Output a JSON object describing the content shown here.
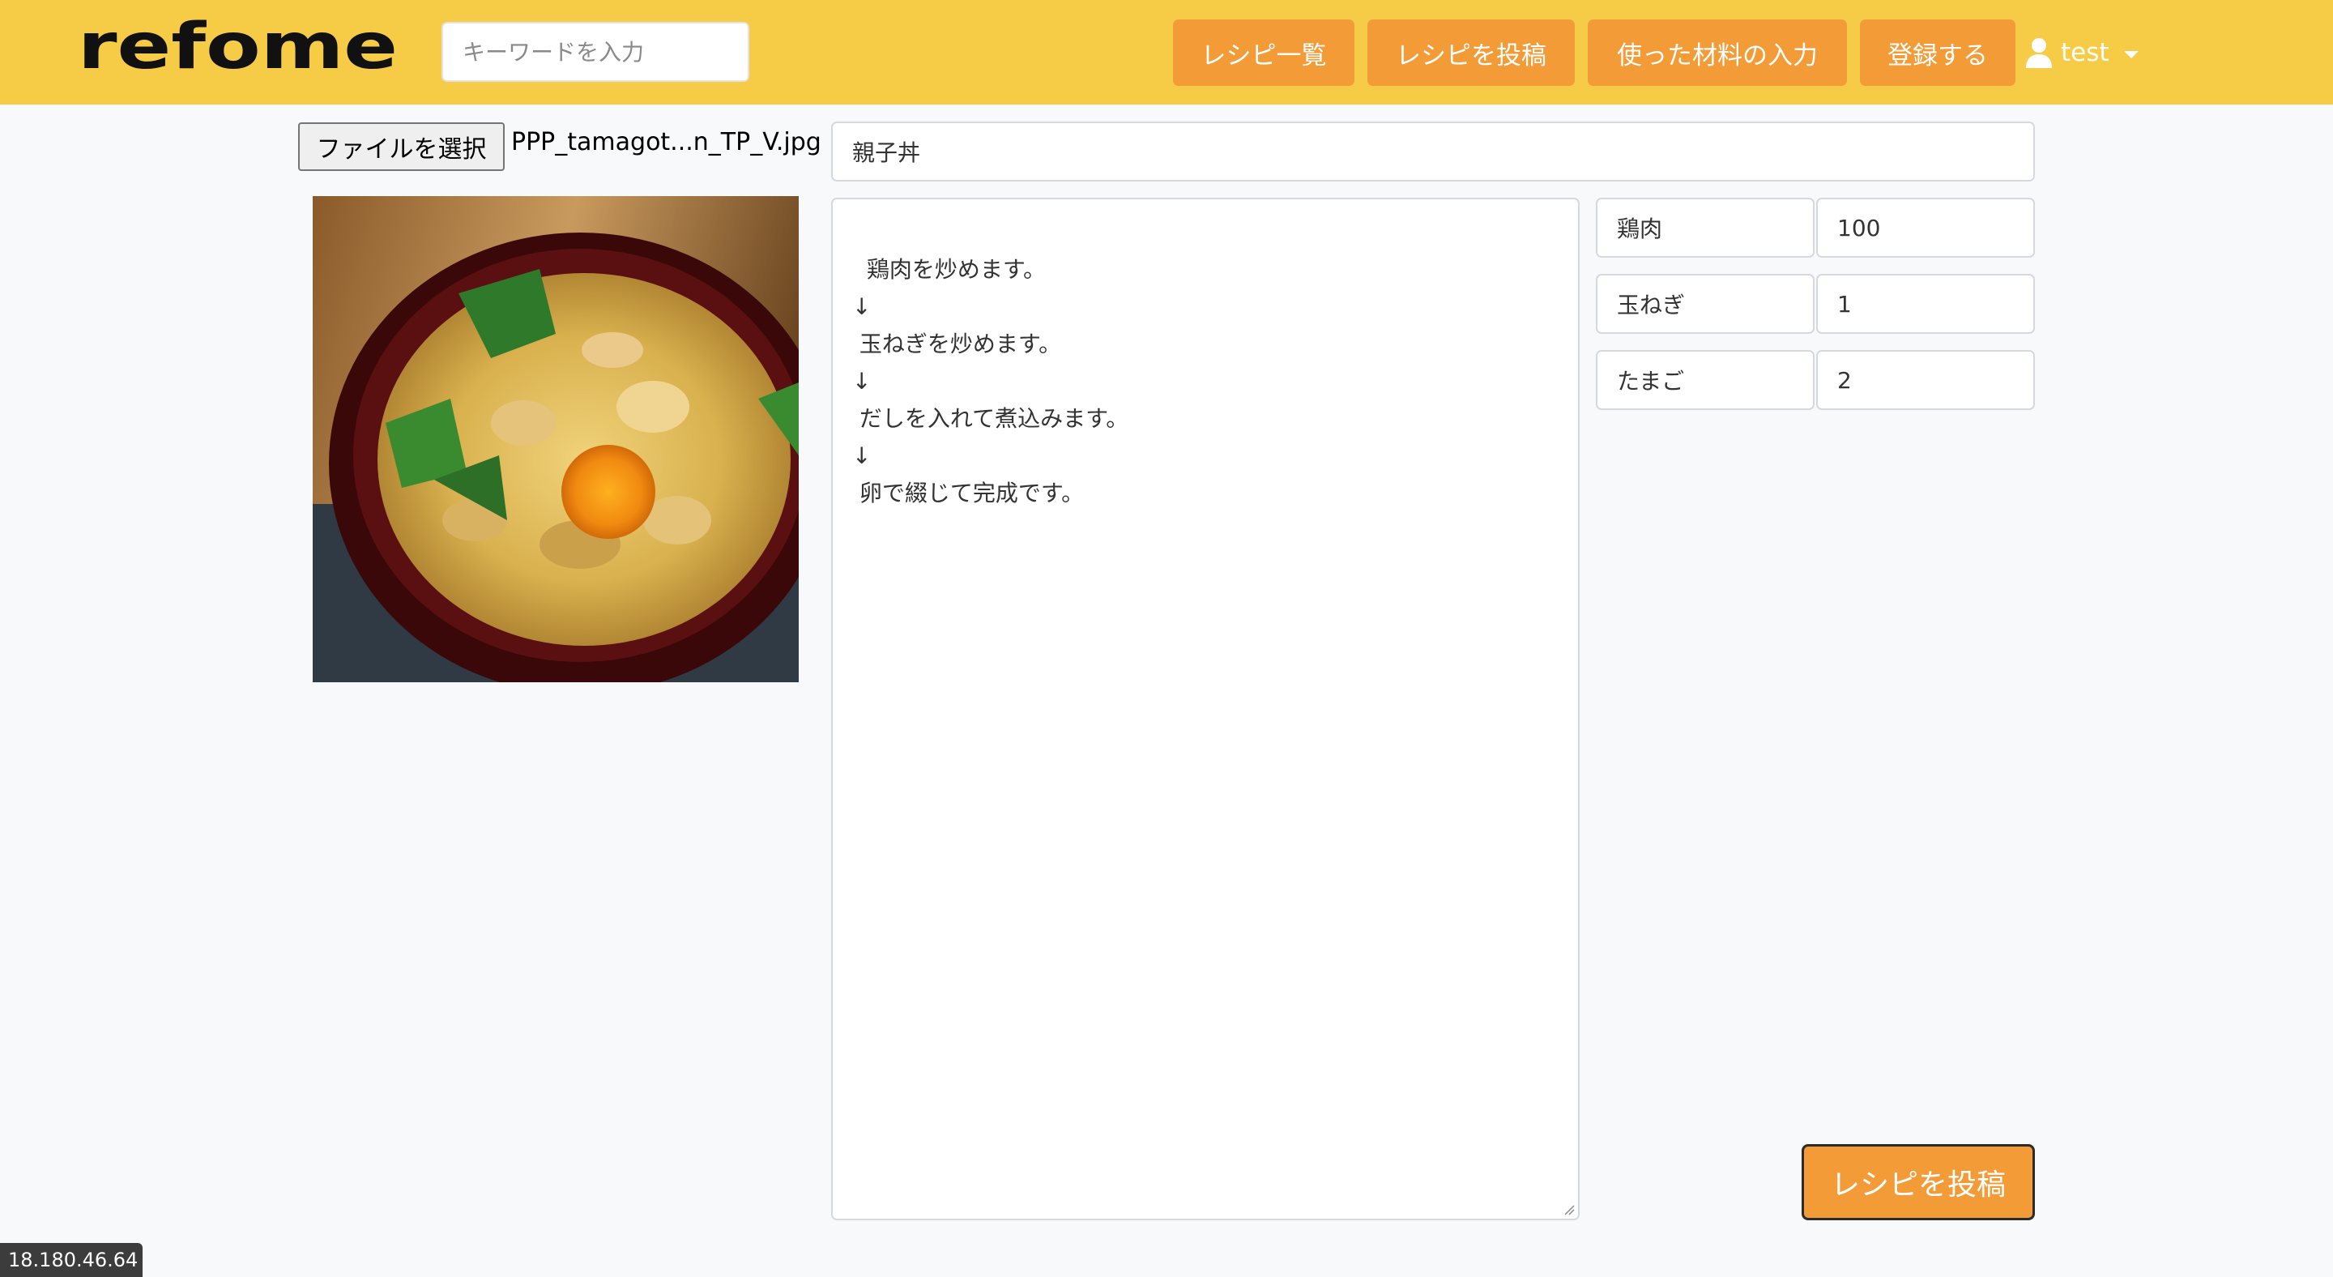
{
  "brand": {
    "logo_text": "refome"
  },
  "search": {
    "placeholder": "キーワードを入力"
  },
  "nav": {
    "recipe_list": "レシピ一覧",
    "post_recipe": "レシピを投稿",
    "ingredients_input": "使った材料の入力",
    "register": "登録する",
    "user_name": "test"
  },
  "colors": {
    "navbar_bg": "#f6cb45",
    "button_orange": "#f29b37"
  },
  "form": {
    "file_button": "ファイルを選択",
    "file_name": "PPP_tamagot...n_TP_V.jpg",
    "image_subject": "oyakodon-photo",
    "title": "親子丼",
    "steps": "鶏肉を炒めます。\n↓\n 玉ねぎを炒めます。\n↓\n だしを入れて煮込みます。\n↓\n 卵で綴じて完成です。",
    "ingredients": [
      {
        "name": "鶏肉",
        "qty": "100"
      },
      {
        "name": "玉ねぎ",
        "qty": "1"
      },
      {
        "name": "たまご",
        "qty": "2"
      }
    ],
    "submit": "レシピを投稿"
  },
  "status_bar": {
    "ip": "18.180.46.64"
  }
}
